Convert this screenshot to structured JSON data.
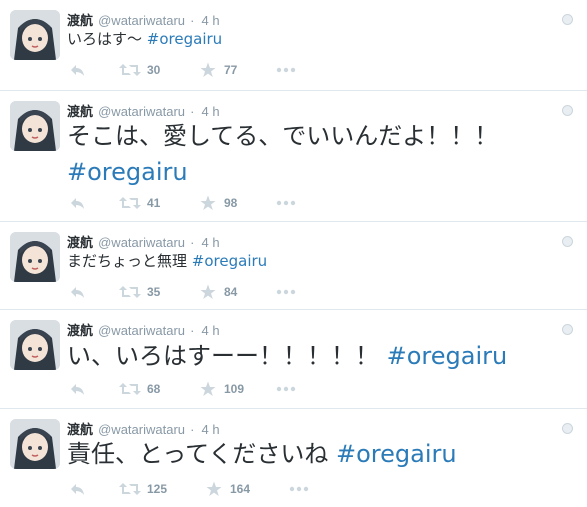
{
  "tweets": [
    {
      "name": "渡航",
      "handle": "@watariwataru",
      "time": "4 h",
      "text": "いろはす〜",
      "hashtag": "#oregairu",
      "retweets": "30",
      "favorites": "77"
    },
    {
      "name": "渡航",
      "handle": "@watariwataru",
      "time": "4 h",
      "text": "そこは、愛してる、でいいんだよ！！！",
      "hashtag": "#oregairu",
      "retweets": "41",
      "favorites": "98"
    },
    {
      "name": "渡航",
      "handle": "@watariwataru",
      "time": "4 h",
      "text": "まだちょっと無理",
      "hashtag": "#oregairu",
      "retweets": "35",
      "favorites": "84"
    },
    {
      "name": "渡航",
      "handle": "@watariwataru",
      "time": "4 h",
      "text": "い、いろはすーー！！！！！",
      "hashtag": "#oregairu",
      "retweets": "68",
      "favorites": "109"
    },
    {
      "name": "渡航",
      "handle": "@watariwataru",
      "time": "4 h",
      "text": "責任、とってくださいね",
      "hashtag": "#oregairu",
      "retweets": "125",
      "favorites": "164"
    }
  ],
  "colors": {
    "hashtag": "#2b7bb9",
    "icon": "#ccd6dd",
    "text": "#292f33",
    "meta": "#8899a6"
  }
}
